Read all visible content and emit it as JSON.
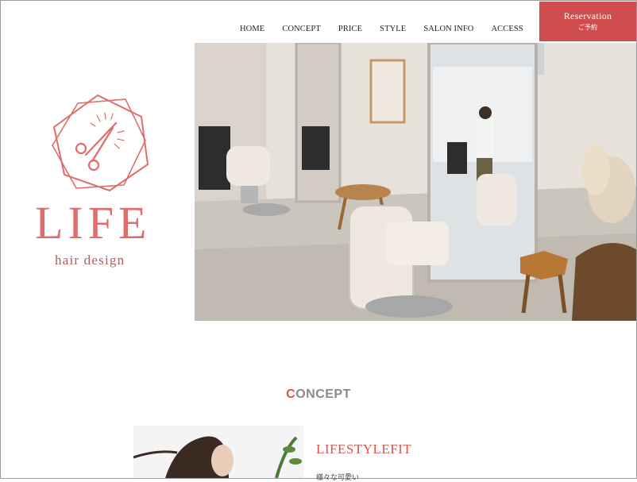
{
  "brand": {
    "name": "LIFE",
    "tagline": "hair design",
    "primary_color": "#e06d6c",
    "accent_color": "#cf4d4c"
  },
  "nav": {
    "items": [
      {
        "label": "HOME"
      },
      {
        "label": "CONCEPT"
      },
      {
        "label": "PRICE"
      },
      {
        "label": "STYLE"
      },
      {
        "label": "SALON INFO"
      },
      {
        "label": "ACCESS"
      }
    ]
  },
  "reservation": {
    "label_en": "Reservation",
    "label_jp": "ご予約"
  },
  "hero": {
    "image": "salon-interior-photo"
  },
  "concept": {
    "heading_first": "C",
    "heading_rest": "ONCEPT",
    "title": "LIFESTYLEFIT",
    "text": "様々な可愛い"
  }
}
